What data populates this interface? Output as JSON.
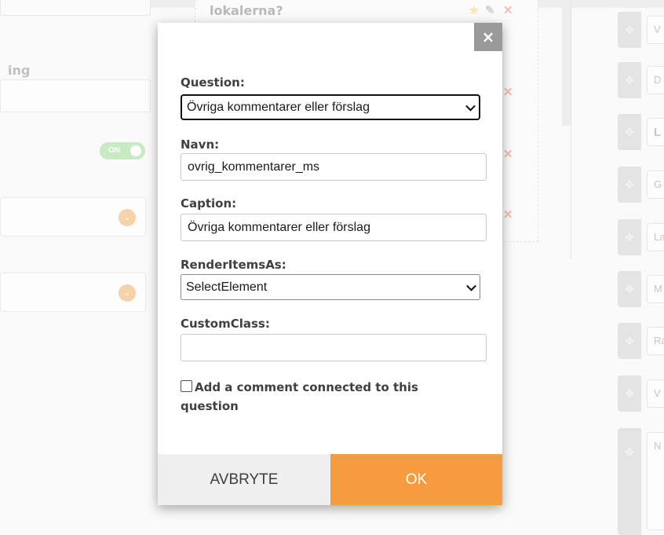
{
  "background": {
    "question_title": "lokalerna?",
    "left_label": "ing",
    "toggle_label": "ON",
    "right_fields": [
      "V",
      "D",
      "L",
      "G",
      "La",
      "M",
      "Ra",
      "V",
      "N"
    ]
  },
  "modal": {
    "close_label": "×",
    "question": {
      "label": "Question:",
      "value": "Övriga kommentarer eller förslag"
    },
    "navn": {
      "label": "Navn:",
      "value": "ovrig_kommentarer_ms"
    },
    "caption": {
      "label": "Caption:",
      "value": "Övriga kommentarer eller förslag"
    },
    "render_items_as": {
      "label": "RenderItemsAs:",
      "value": "SelectElement"
    },
    "custom_class": {
      "label": "CustomClass:",
      "value": ""
    },
    "comment_checkbox": {
      "label": "Add a comment connected to this question",
      "checked": false
    },
    "cancel_label": "AVBRYTE",
    "ok_label": "OK"
  },
  "colors": {
    "accent": "#f59c3f",
    "cancel_bg": "#efefef",
    "close_bg": "#9a9a9a"
  }
}
